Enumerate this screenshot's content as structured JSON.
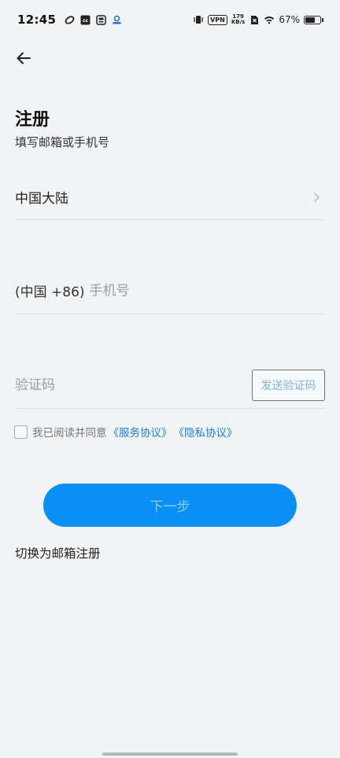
{
  "status_bar": {
    "time": "12:45",
    "vpn": "VPN",
    "speed_value": "179",
    "speed_unit": "KB/s",
    "battery": "67%",
    "battery_level": 0.67
  },
  "header": {
    "back_icon": "arrow-left-icon"
  },
  "page": {
    "title": "注册",
    "subtitle": "填写邮箱或手机号"
  },
  "form": {
    "region_label": "中国大陆",
    "phone_prefix": "(中国 +86)",
    "phone_placeholder": "手机号",
    "code_placeholder": "验证码",
    "send_code_label": "发送验证码",
    "agree_text": "我已阅读并同意",
    "service_agreement": "《服务协议》",
    "privacy_agreement": "《隐私协议》",
    "agreed": false
  },
  "actions": {
    "next_label": "下一步",
    "switch_label": "切换为邮箱注册"
  },
  "colors": {
    "background": "#f2f3f5",
    "primary": "#0a8ff5",
    "link": "#1a7fd6"
  }
}
